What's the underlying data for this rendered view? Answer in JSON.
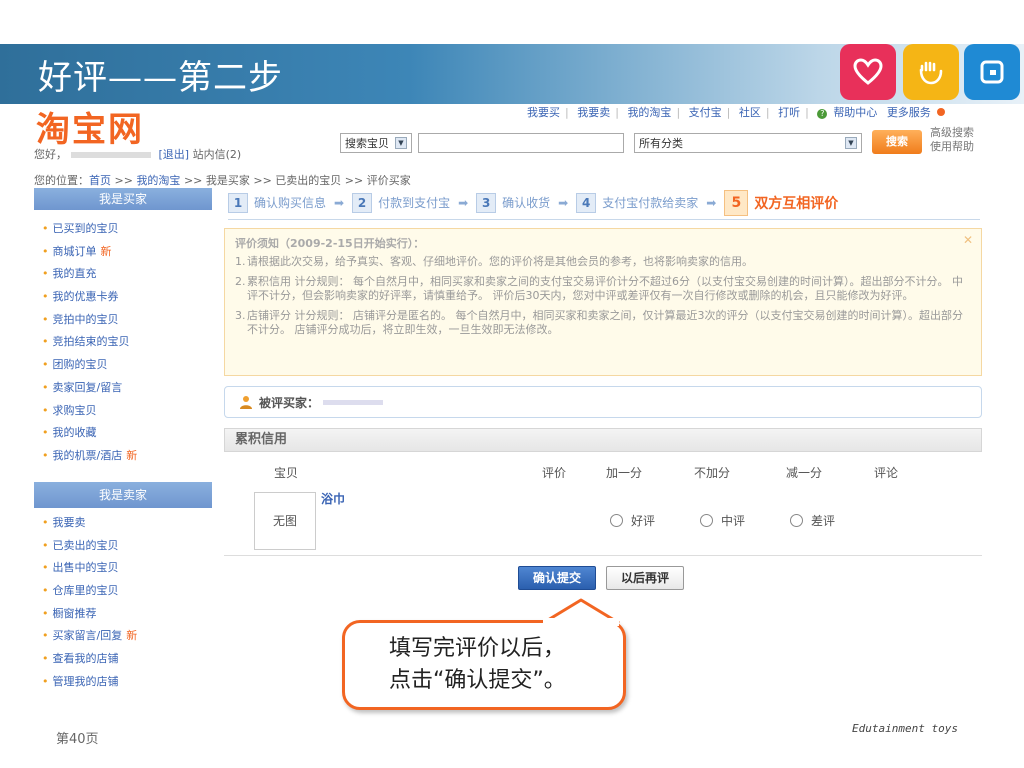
{
  "slide": {
    "title": "好评——第二步",
    "page_number": "第40页",
    "brand": "Edutainment toys",
    "callout_line1": "填写完评价以后，",
    "callout_line2": "点击“确认提交”。",
    "colors": {
      "heart": "#e8305a",
      "hand": "#f5b515",
      "square": "#1f8ad4",
      "accent": "#f26522"
    }
  },
  "header": {
    "logo": "淘宝网",
    "topnav": [
      "我要买",
      "我要卖",
      "我的淘宝",
      "支付宝",
      "社区",
      "打听",
      "帮助中心",
      "更多服务"
    ],
    "greeting_prefix": "您好，",
    "logout": "[退出]",
    "messages": "站内信(2)",
    "search_scope": "搜索宝贝",
    "category": "所有分类",
    "search_button": "搜索",
    "advanced_search": "高级搜索",
    "usage_help": "使用帮助"
  },
  "breadcrumb": {
    "prefix": "您的位置：",
    "home": "首页",
    "my_taobao": "我的淘宝",
    "rest": ">> 我是买家 >> 已卖出的宝贝 >> 评价买家"
  },
  "sidebar": {
    "buyer_title": "我是买家",
    "buyer_items": [
      {
        "label": "已买到的宝贝",
        "new": ""
      },
      {
        "label": "商城订单",
        "new": "新"
      },
      {
        "label": "我的直充",
        "new": ""
      },
      {
        "label": "我的优惠卡券",
        "new": ""
      },
      {
        "label": "竞拍中的宝贝",
        "new": ""
      },
      {
        "label": "竞拍结束的宝贝",
        "new": ""
      },
      {
        "label": "团购的宝贝",
        "new": ""
      },
      {
        "label": "卖家回复/留言",
        "new": ""
      },
      {
        "label": "求购宝贝",
        "new": ""
      },
      {
        "label": "我的收藏",
        "new": ""
      },
      {
        "label": "我的机票/酒店",
        "new": "新"
      }
    ],
    "seller_title": "我是卖家",
    "seller_items": [
      {
        "label": "我要卖",
        "new": ""
      },
      {
        "label": "已卖出的宝贝",
        "new": ""
      },
      {
        "label": "出售中的宝贝",
        "new": ""
      },
      {
        "label": "仓库里的宝贝",
        "new": ""
      },
      {
        "label": "橱窗推荐",
        "new": ""
      },
      {
        "label": "买家留言/回复",
        "new": "新"
      },
      {
        "label": "查看我的店铺",
        "new": ""
      },
      {
        "label": "管理我的店铺",
        "new": ""
      }
    ]
  },
  "steps": [
    {
      "num": "1",
      "label": "确认购买信息"
    },
    {
      "num": "2",
      "label": "付款到支付宝"
    },
    {
      "num": "3",
      "label": "确认收货"
    },
    {
      "num": "4",
      "label": "支付宝付款给卖家"
    },
    {
      "num": "5",
      "label": "双方互相评价"
    }
  ],
  "notice": {
    "title": "评价须知（2009-2-15日开始实行）：",
    "items": [
      "请根据此次交易，给予真实、客观、仔细地评价。您的评价将是其他会员的参考，也将影响卖家的信用。",
      "累积信用 计分规则： 每个自然月中，相同买家和卖家之间的支付宝交易评价计分不超过6分（以支付宝交易创建的时间计算）。超出部分不计分。 中评不计分，但会影响卖家的好评率，请慎重给予。 评价后30天内，您对中评或差评仅有一次自行修改或删除的机会，且只能修改为好评。",
      "店铺评分 计分规则： 店铺评分是匿名的。 每个自然月中，相同买家和卖家之间，仅计算最近3次的评分（以支付宝交易创建的时间计算）。超出部分不计分。 店铺评分成功后，将立即生效，一旦生效即无法修改。"
    ]
  },
  "buyer_label": "被评买家：",
  "credit": {
    "title": "累积信用",
    "columns": [
      "宝贝",
      "评价",
      "加一分",
      "不加分",
      "减一分",
      "评论"
    ],
    "item_name": "浴巾",
    "no_image": "无图",
    "options": [
      "好评",
      "中评",
      "差评"
    ]
  },
  "actions": {
    "confirm": "确认提交",
    "later": "以后再评"
  }
}
